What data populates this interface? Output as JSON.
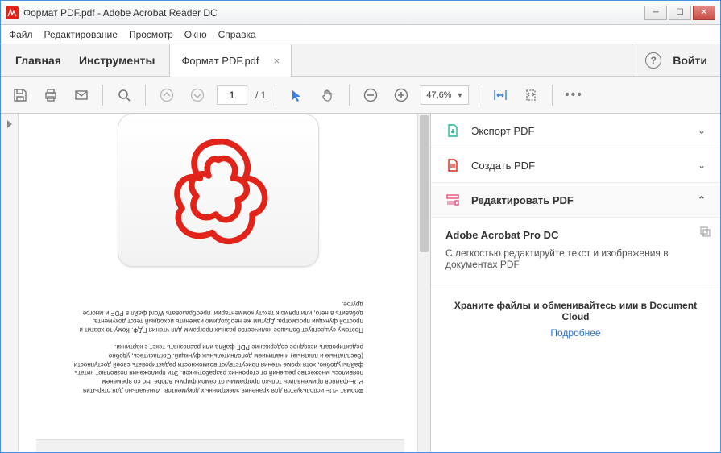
{
  "window": {
    "title": "Формат PDF.pdf - Adobe Acrobat Reader DC"
  },
  "menu": {
    "file": "Файл",
    "edit": "Редактирование",
    "view": "Просмотр",
    "window": "Окно",
    "help": "Справка"
  },
  "tabs": {
    "home": "Главная",
    "tools": "Инструменты",
    "doc": "Формат PDF.pdf",
    "signin": "Войти"
  },
  "toolbar": {
    "page_current": "1",
    "page_total": "/ 1",
    "zoom": "47,6%"
  },
  "doc_text": {
    "p1": "Формат PDF используется для хранения электронных документов. Изначально для открытия PDF-файлов применялись только программы от самой фирмы Adobe. Но со временем появилось множество решений от сторонних разработчиков. Эти приложения позволяют читать файлы удобно, хотя кроме чтения присутствуют возможности редактировать своей доступности (бесплатные и платные) и наличием дополнительных функций. Согласитесь, удобно редактировать исходное содержание PDF файла или распознать текст с картинки.",
    "p2": "Поэтому существует большое количество разных программ для чтения ПДФ. Кому-то хватит и простой функции просмотра. Другим же необходимо изменить исходный текст документа, добавить в него, или прямо к тексту комментарии, преобразовать Word файл в PDF и многое другое."
  },
  "right": {
    "export": "Экспорт PDF",
    "create": "Создать PDF",
    "edit": "Редактировать PDF",
    "promo_title": "Adobe Acrobat Pro DC",
    "promo_text": "С легкостью редактируйте текст и изображения в документах PDF",
    "cloud_text": "Храните файлы и обменивайтесь ими в Document Cloud",
    "cloud_link": "Подробнее"
  },
  "colors": {
    "adobe_red": "#e2231a",
    "accent_blue": "#3a7ee4",
    "teal": "#1fb697",
    "pink": "#e84f7a"
  }
}
